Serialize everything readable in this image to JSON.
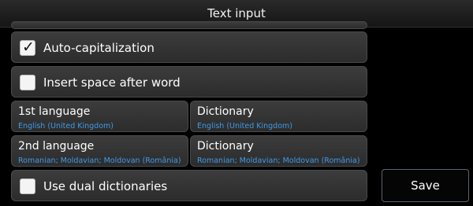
{
  "header": {
    "title": "Text input"
  },
  "settings": {
    "auto_capitalization": {
      "label": "Auto-capitalization",
      "checked": true
    },
    "insert_space": {
      "label": "Insert space after word",
      "checked": false
    },
    "language1": {
      "title": "1st language",
      "value": "English (United Kingdom)"
    },
    "dictionary1": {
      "title": "Dictionary",
      "value": "English (United Kingdom)"
    },
    "language2": {
      "title": "2nd language",
      "value": "Romanian; Moldavian; Moldovan (România)"
    },
    "dictionary2": {
      "title": "Dictionary",
      "value": "Romanian; Moldavian; Moldovan (România)"
    },
    "dual_dictionaries": {
      "label": "Use dual dictionaries",
      "checked": false
    }
  },
  "actions": {
    "save_label": "Save"
  },
  "colors": {
    "accent_value": "#3f9be8",
    "panel": "#333333",
    "background": "#000000"
  }
}
